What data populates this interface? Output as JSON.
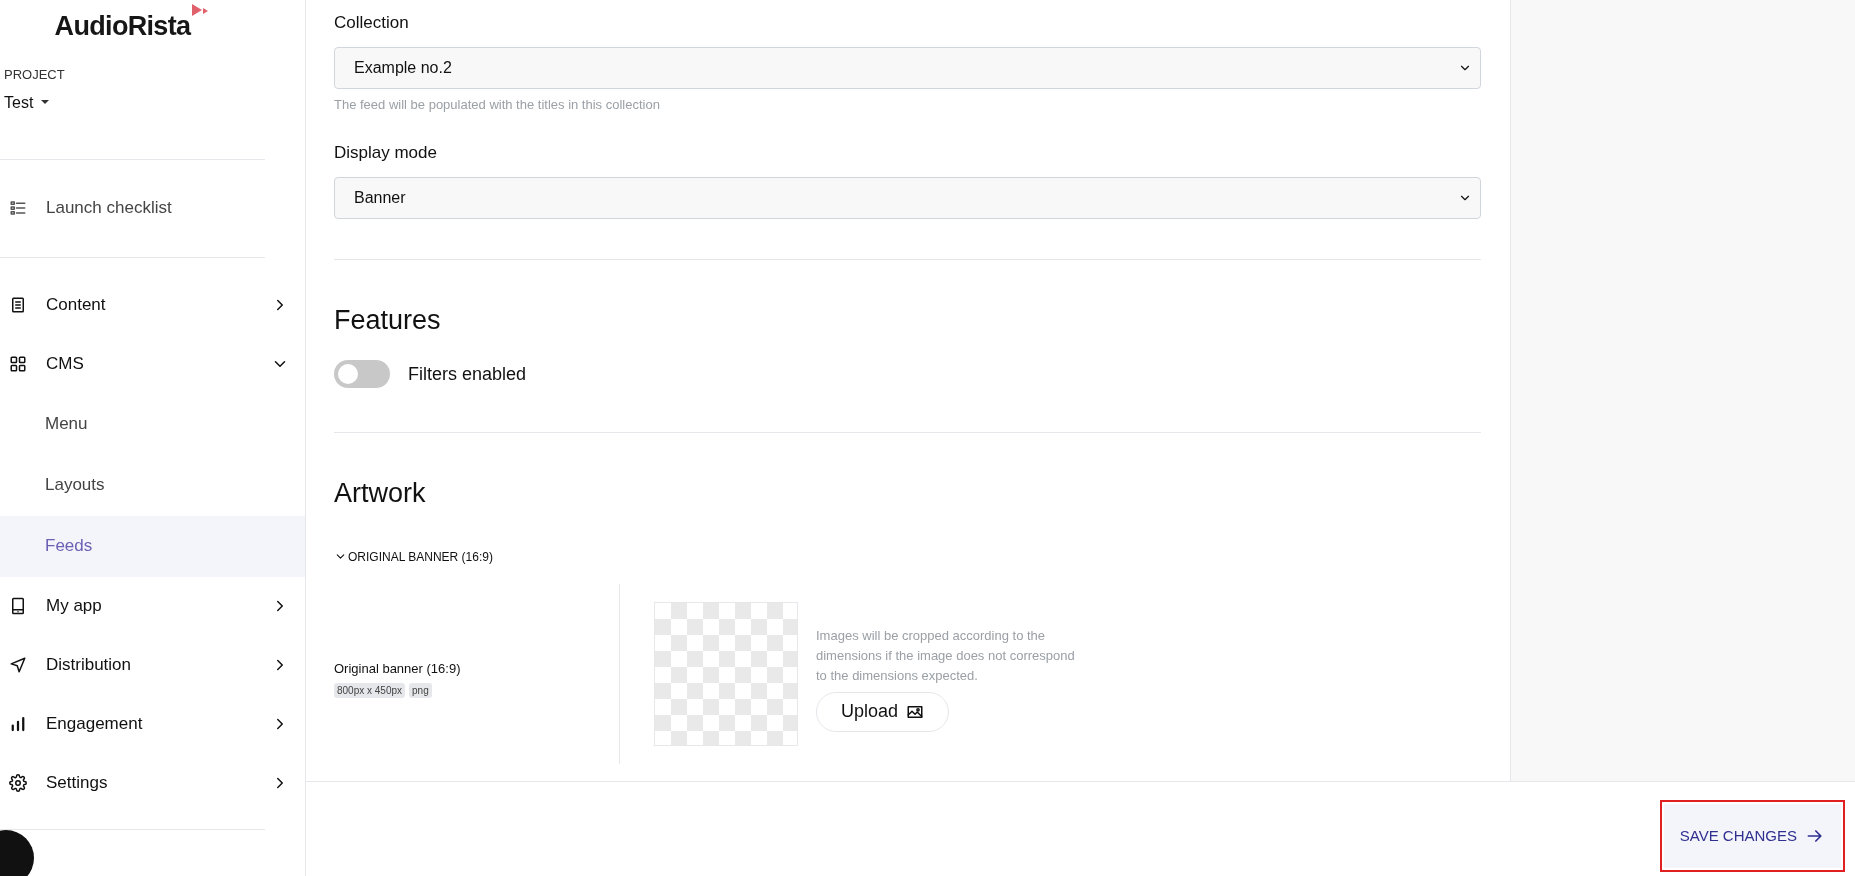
{
  "sidebar": {
    "logo": "AudioRista",
    "project_label": "PROJECT",
    "project_name": "Test",
    "top_items": [
      {
        "label": "Launch checklist",
        "kind": "checklist"
      }
    ],
    "nav": [
      {
        "label": "Content",
        "kind": "document",
        "expanded": false
      },
      {
        "label": "CMS",
        "kind": "grid",
        "expanded": true,
        "children": [
          {
            "label": "Menu",
            "selected": false
          },
          {
            "label": "Layouts",
            "selected": false
          },
          {
            "label": "Feeds",
            "selected": true
          }
        ]
      },
      {
        "label": "My app",
        "kind": "tablet",
        "expanded": false
      },
      {
        "label": "Distribution",
        "kind": "send",
        "expanded": false
      },
      {
        "label": "Engagement",
        "kind": "bars",
        "expanded": false
      },
      {
        "label": "Settings",
        "kind": "gear",
        "expanded": false
      }
    ]
  },
  "form": {
    "fields": [
      {
        "label": "Collection",
        "value": "Example no.2",
        "hint": "The feed will be populated with the titles in this collection"
      },
      {
        "label": "Display mode",
        "value": "Banner"
      }
    ],
    "features": {
      "title": "Features",
      "toggles": [
        {
          "label": "Filters enabled",
          "on": false
        }
      ]
    },
    "artwork": {
      "title": "Artwork",
      "section": {
        "title": "ORIGINAL BANNER (16:9)",
        "expanded": true,
        "name": "Original banner (16:9)",
        "tags": [
          "800px x 450px",
          "png"
        ],
        "note": "Images will be cropped according to the dimensions if the image does not correspond to the dimensions expected.",
        "upload_button": "Upload"
      }
    }
  },
  "footer": {
    "save_button": "SAVE CHANGES"
  }
}
